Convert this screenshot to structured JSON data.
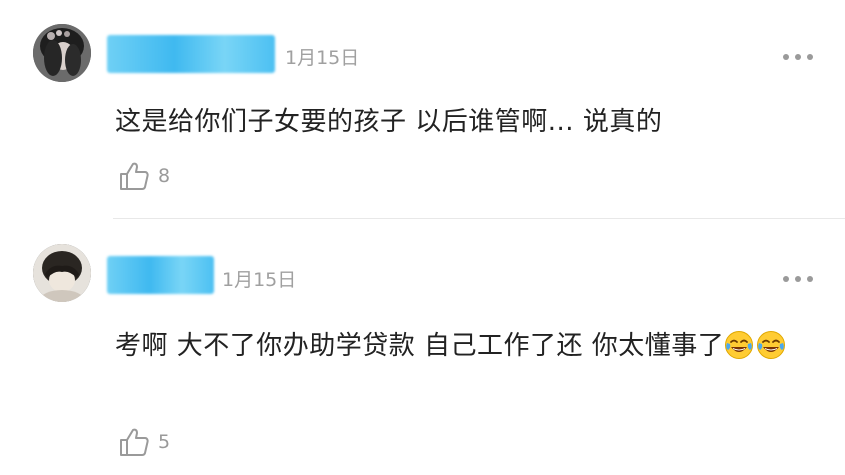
{
  "comments": [
    {
      "date": "1月15日",
      "text": "这是给你们子女要的孩子 以后谁管啊... 说真的",
      "emoji": [],
      "like_count": "8"
    },
    {
      "date": "1月15日",
      "text": "考啊 大不了你办助学贷款 自己工作了还 你太懂事了",
      "emoji": [
        "tears-of-joy",
        "tears-of-joy"
      ],
      "like_count": "5"
    }
  ],
  "colors": {
    "username_blur": "#3fb9f0",
    "date": "#a0a0a0",
    "text": "#222222",
    "meta": "#9a9a9a",
    "divider": "#e8e8e8"
  }
}
